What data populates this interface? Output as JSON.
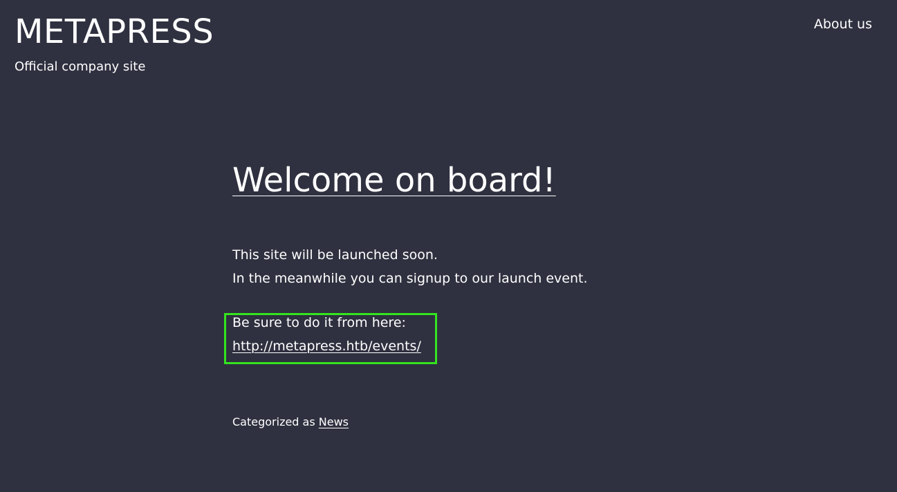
{
  "header": {
    "site_title": "METAPRESS",
    "tagline": "Official company site",
    "nav": {
      "about": "About us"
    }
  },
  "post": {
    "title": "Welcome on board!",
    "line1": "This site will be launched soon.",
    "line2": "In the meanwhile you can signup to our launch event.",
    "line3": "Be sure to do it from here:",
    "link": "http://metapress.htb/events/",
    "category_prefix": "Categorized as ",
    "category": "News"
  },
  "colors": {
    "background": "#2f3140",
    "text": "#ffffff",
    "highlight_box": "#33e51e"
  }
}
